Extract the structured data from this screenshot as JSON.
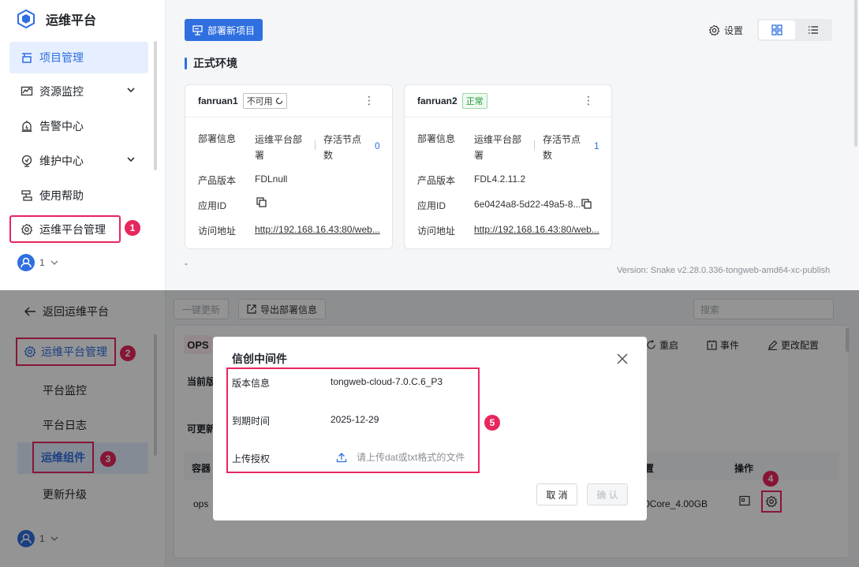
{
  "app": {
    "title": "运维平台"
  },
  "sidebar": {
    "items": [
      {
        "label": "项目管理",
        "icon": "project-icon",
        "active": true
      },
      {
        "label": "资源监控",
        "icon": "monitor-icon",
        "expandable": true
      },
      {
        "label": "告警中心",
        "icon": "alarm-icon"
      },
      {
        "label": "维护中心",
        "icon": "maintenance-icon",
        "expandable": true
      },
      {
        "label": "使用帮助",
        "icon": "help-icon"
      },
      {
        "label": "运维平台管理",
        "icon": "gear-icon"
      }
    ],
    "user": {
      "name": "1"
    }
  },
  "toolbar": {
    "deploy_label": "部署新项目",
    "settings_label": "设置"
  },
  "section": {
    "title": "正式环境"
  },
  "cards": [
    {
      "name": "fanruan1",
      "status": "不可用",
      "status_color": "gray",
      "deploy_label": "部署信息",
      "deploy_value": "运维平台部署",
      "nodes_label": "存活节点数",
      "nodes_value": "0",
      "version_label": "产品版本",
      "version_value": "FDLnull",
      "appid_label": "应用ID",
      "appid_value": "",
      "url_label": "访问地址",
      "url_value": "http://192.168.16.43:80/web..."
    },
    {
      "name": "fanruan2",
      "status": "正常",
      "status_color": "green",
      "deploy_label": "部署信息",
      "deploy_value": "运维平台部署",
      "nodes_label": "存活节点数",
      "nodes_value": "1",
      "version_label": "产品版本",
      "version_value": "FDL4.2.11.2",
      "appid_label": "应用ID",
      "appid_value": "6e0424a8-5d22-49a5-8...",
      "url_label": "访问地址",
      "url_value": "http://192.168.16.43:80/web..."
    }
  ],
  "footer": {
    "dash": "-",
    "version": "Version: Snake v2.28.0.336-tongweb-amd64-xc-publish"
  },
  "bottom_sidebar": {
    "back_label": "返回运维平台",
    "group_label": "运维平台管理",
    "items": [
      "平台监控",
      "平台日志",
      "运维组件",
      "更新升级"
    ],
    "active_index": 2,
    "user": {
      "name": "1"
    }
  },
  "bottom_toolbar": {
    "update_all": "一键更新",
    "export_label": "导出部署信息",
    "search_placeholder": "搜索"
  },
  "ops_panel": {
    "tab": "OPS",
    "actions": [
      "重启",
      "事件",
      "更改配置"
    ],
    "current_label": "当前版",
    "updatable_label": "可更新",
    "container_header": "容器",
    "config_header": "置",
    "ops_header": "操作",
    "row_name": "ops",
    "row_config": "0Core_4.00GB"
  },
  "annotations": [
    "1",
    "2",
    "3",
    "4",
    "5"
  ],
  "modal": {
    "title": "信创中间件",
    "version_label": "版本信息",
    "version_value": "tongweb-cloud-7.0.C.6_P3",
    "expire_label": "到期时间",
    "expire_value": "2025-12-29",
    "upload_label": "上传授权",
    "upload_hint": "请上传dat或txt格式的文件",
    "cancel_label": "取 消",
    "confirm_label": "确 认"
  },
  "colors": {
    "primary": "#2f6fe0",
    "highlight": "#e8265e",
    "success": "#1f9a3a"
  }
}
